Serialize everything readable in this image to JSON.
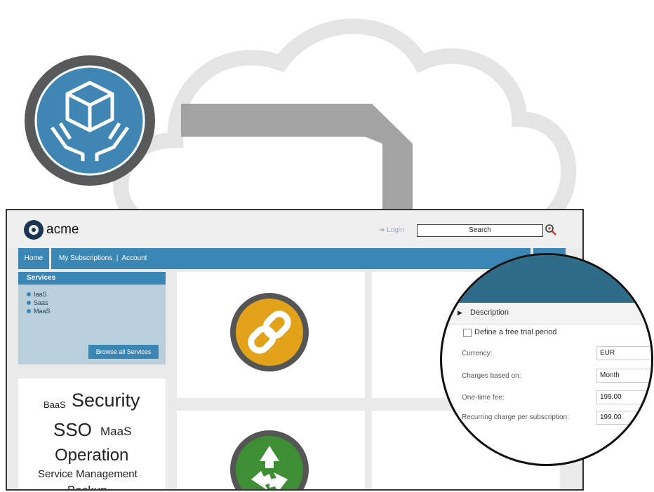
{
  "app": {
    "logo_text": "acme",
    "login_label": "Login",
    "search": {
      "value": "Search"
    },
    "nav": {
      "home": "Home",
      "links": [
        "My Subscriptions",
        "Account"
      ],
      "separator": "|"
    },
    "services": {
      "title": "Services",
      "items": [
        "IaaS",
        "Saas",
        "MaaS"
      ],
      "browse_button": "Browse all Services"
    },
    "tag_cloud": [
      "BaaS",
      "Security",
      "SSO",
      "MaaS",
      "Operation",
      "Service Management",
      "Backup"
    ]
  },
  "form": {
    "section_label": "Description",
    "trial_checkbox_label": "Define a free trial period",
    "trial_checked": false,
    "rows": [
      {
        "label": "Currency:",
        "value": "EUR"
      },
      {
        "label": "Charges based on:",
        "value": "Month"
      },
      {
        "label": "One-time fee:",
        "value": "199.00"
      },
      {
        "label": "Recurring charge per subscription:",
        "value": "199.00"
      }
    ]
  },
  "colors": {
    "nav_blue": "#3a86b4",
    "services_panel": "#b9cfdb",
    "package_icon_bg": "#3f86b5",
    "link_icon_bg": "#e2a21a",
    "recycle_icon_bg": "#3e8f33",
    "magnifier_header": "#2f6c8a"
  },
  "icons": [
    "package-hands-icon",
    "link-icon",
    "recycle-icon",
    "search-icon",
    "login-arrow-icon"
  ]
}
